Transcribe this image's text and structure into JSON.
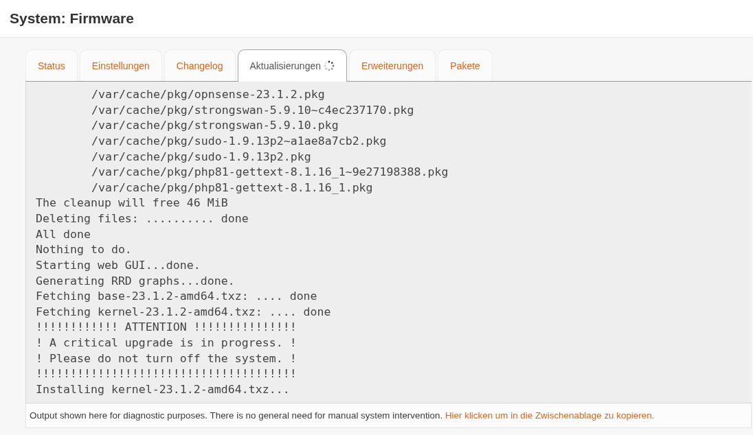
{
  "page": {
    "title": "System: Firmware"
  },
  "tabs": [
    {
      "label": "Status",
      "selected": false,
      "busy": false
    },
    {
      "label": "Einstellungen",
      "selected": false,
      "busy": false
    },
    {
      "label": "Changelog",
      "selected": false,
      "busy": false
    },
    {
      "label": "Aktualisierungen",
      "selected": true,
      "busy": true
    },
    {
      "label": "Erweiterungen",
      "selected": false,
      "busy": false
    },
    {
      "label": "Pakete",
      "selected": false,
      "busy": false
    }
  ],
  "log": {
    "lines": [
      {
        "text": "/var/cache/pkg/opnsense-23.1.2.pkg",
        "indented": true
      },
      {
        "text": "/var/cache/pkg/strongswan-5.9.10~c4ec237170.pkg",
        "indented": true
      },
      {
        "text": "/var/cache/pkg/strongswan-5.9.10.pkg",
        "indented": true
      },
      {
        "text": "/var/cache/pkg/sudo-1.9.13p2~a1ae8a7cb2.pkg",
        "indented": true
      },
      {
        "text": "/var/cache/pkg/sudo-1.9.13p2.pkg",
        "indented": true
      },
      {
        "text": "/var/cache/pkg/php81-gettext-8.1.16_1~9e27198388.pkg",
        "indented": true
      },
      {
        "text": "/var/cache/pkg/php81-gettext-8.1.16_1.pkg",
        "indented": true
      },
      {
        "text": "The cleanup will free 46 MiB",
        "indented": false
      },
      {
        "text": "Deleting files: .......... done",
        "indented": false
      },
      {
        "text": "All done",
        "indented": false
      },
      {
        "text": "Nothing to do.",
        "indented": false
      },
      {
        "text": "Starting web GUI...done.",
        "indented": false
      },
      {
        "text": "Generating RRD graphs...done.",
        "indented": false
      },
      {
        "text": "Fetching base-23.1.2-amd64.txz: .... done",
        "indented": false
      },
      {
        "text": "Fetching kernel-23.1.2-amd64.txz: .... done",
        "indented": false
      },
      {
        "text": "!!!!!!!!!!!! ATTENTION !!!!!!!!!!!!!!!",
        "indented": false
      },
      {
        "text": "! A critical upgrade is in progress. !",
        "indented": false
      },
      {
        "text": "! Please do not turn off the system. !",
        "indented": false
      },
      {
        "text": "!!!!!!!!!!!!!!!!!!!!!!!!!!!!!!!!!!!!!!",
        "indented": false
      },
      {
        "text": "Installing kernel-23.1.2-amd64.txz...",
        "indented": false
      }
    ]
  },
  "footer": {
    "note": "Output shown here for diagnostic purposes. There is no general need for manual system intervention.",
    "link": "Hier klicken um in die Zwischenablage zu kopieren."
  }
}
